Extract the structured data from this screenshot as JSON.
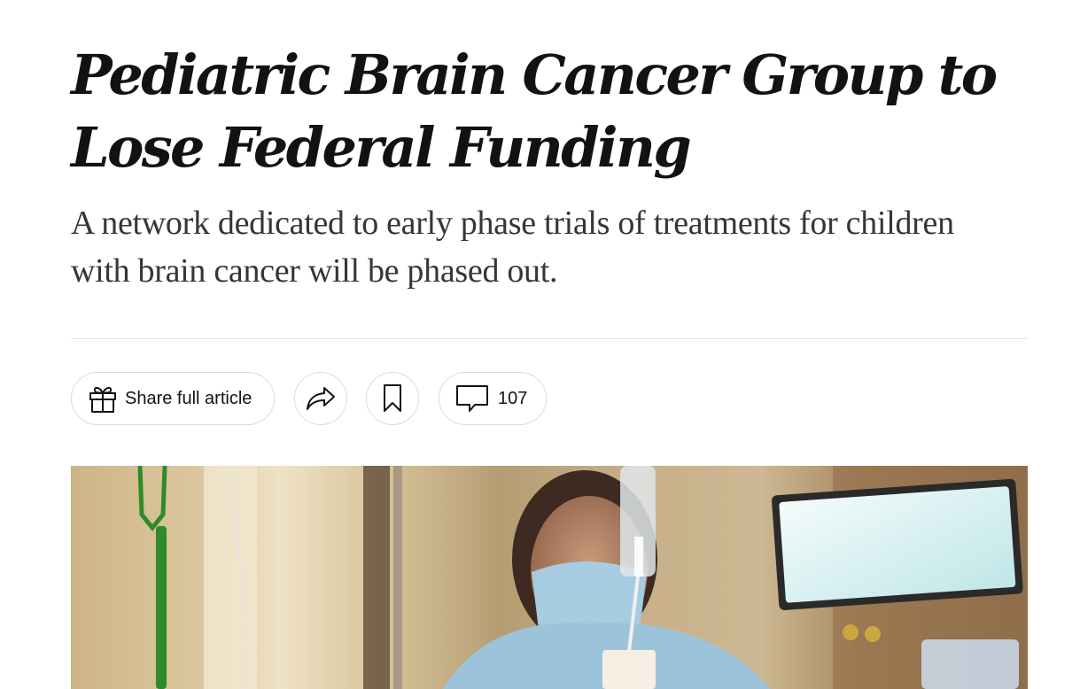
{
  "article": {
    "headline": "Pediatric Brain Cancer Group to Lose Federal Funding",
    "summary": "A network dedicated to early phase trials of treatments for children with brain cancer will be phased out."
  },
  "actions": {
    "share_full_label": "Share full article",
    "share_icon": "share-arrow-icon",
    "save_icon": "bookmark-icon",
    "comment_icon": "speech-bubble-icon",
    "comments_count": "107"
  },
  "colors": {
    "headline": "#121212",
    "summary": "#363636",
    "border": "#dcdcdc"
  }
}
